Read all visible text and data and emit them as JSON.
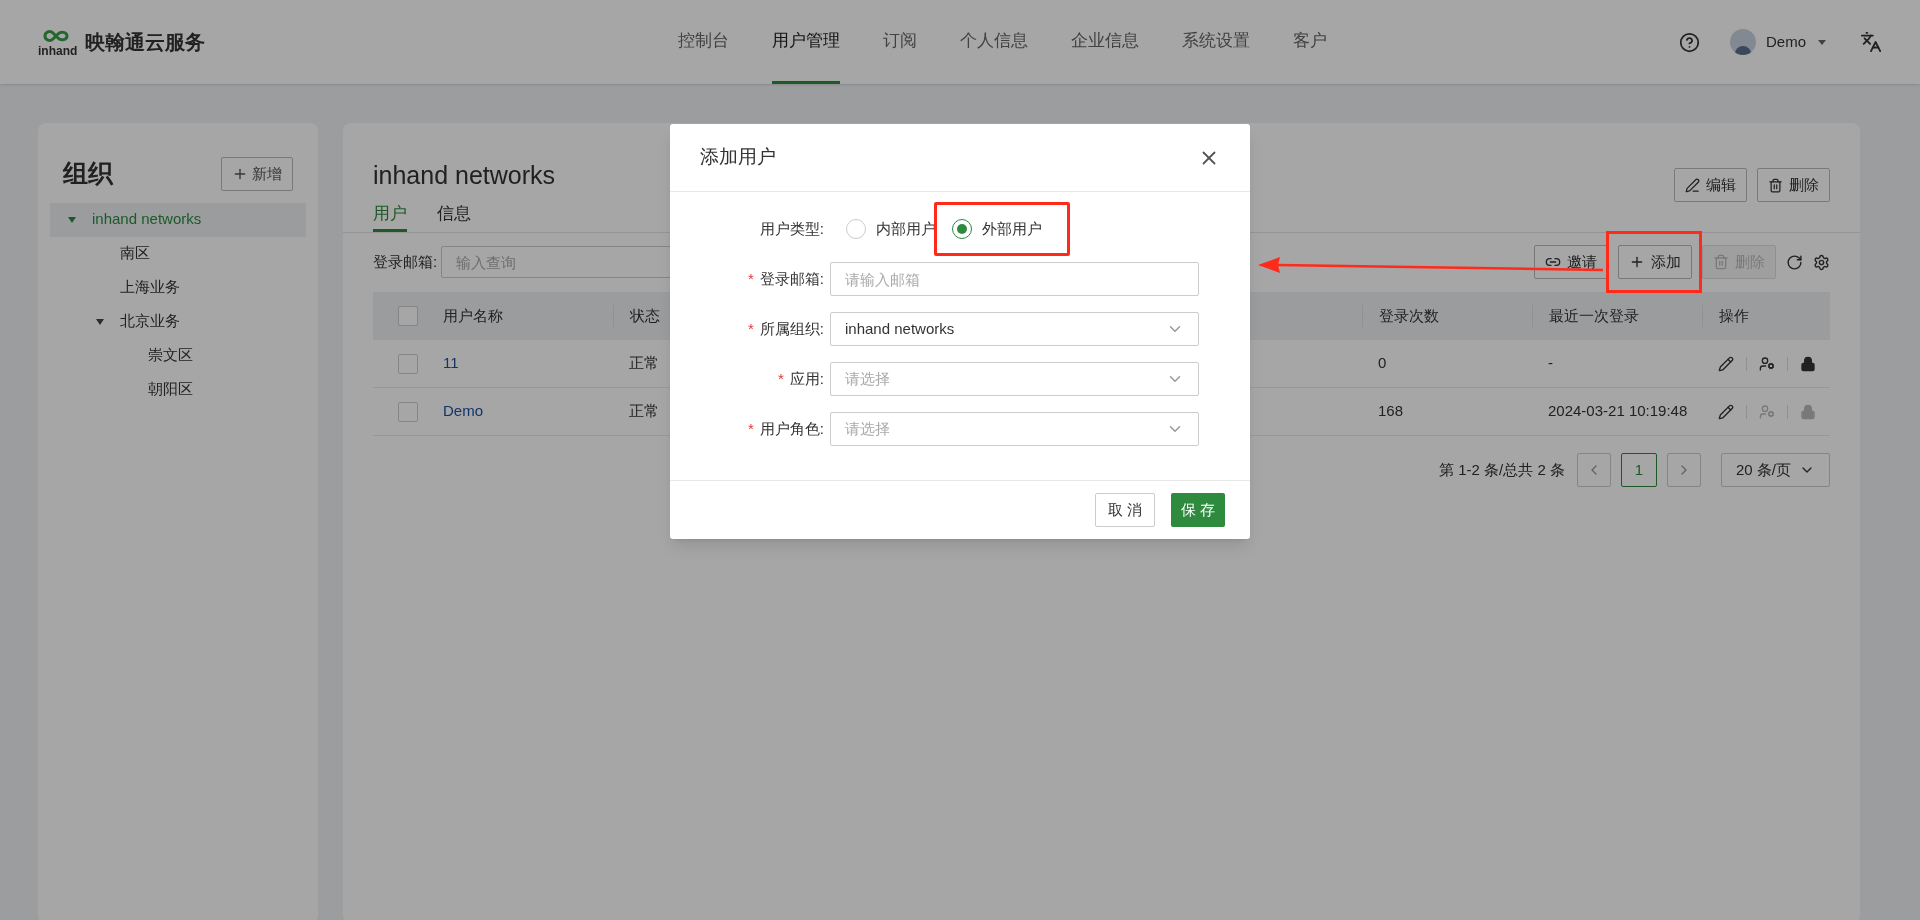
{
  "header": {
    "brand": "映翰通云服务",
    "logo_text": "inhand",
    "nav": [
      {
        "label": "控制台",
        "selected": false
      },
      {
        "label": "用户管理",
        "selected": true
      },
      {
        "label": "订阅",
        "selected": false
      },
      {
        "label": "个人信息",
        "selected": false
      },
      {
        "label": "企业信息",
        "selected": false
      },
      {
        "label": "系统设置",
        "selected": false
      },
      {
        "label": "客户",
        "selected": false
      }
    ],
    "user": "Demo"
  },
  "org_panel": {
    "title": "组织",
    "add_button": "新增",
    "tree": [
      {
        "label": "inhand networks",
        "selected": true,
        "expanded": true,
        "children": [
          {
            "label": "南区",
            "selected": false
          },
          {
            "label": "上海业务",
            "selected": false
          },
          {
            "label": "北京业务",
            "selected": false,
            "expanded": true,
            "children": [
              {
                "label": "崇文区",
                "selected": false
              },
              {
                "label": "朝阳区",
                "selected": false
              }
            ]
          }
        ]
      }
    ]
  },
  "main": {
    "title": "inhand networks",
    "edit_button": "编辑",
    "delete_button": "删除",
    "tabs": [
      {
        "label": "用户",
        "selected": true
      },
      {
        "label": "信息",
        "selected": false
      }
    ],
    "filter": {
      "label": "登录邮箱:",
      "placeholder": "输入查询"
    },
    "toolbar": [
      {
        "label": "邀请",
        "kind": "invite",
        "disabled": false,
        "highlighted": false
      },
      {
        "label": "添加",
        "kind": "add",
        "disabled": false,
        "highlighted": true
      },
      {
        "label": "删除",
        "kind": "delete",
        "disabled": true,
        "highlighted": false
      }
    ],
    "table": {
      "all_selected": false,
      "columns": [
        "用户名称",
        "状态",
        "登录次数",
        "最近一次登录",
        "操作"
      ],
      "rows": [
        {
          "selected": false,
          "name": "11",
          "status": "正常",
          "logins": "0",
          "last_login": "-",
          "actions": [
            {
              "kind": "edit",
              "disabled": false
            },
            {
              "kind": "switch-user",
              "disabled": false
            },
            {
              "kind": "lock",
              "disabled": false
            }
          ]
        },
        {
          "selected": false,
          "name": "Demo",
          "status": "正常",
          "logins": "168",
          "last_login": "2024-03-21 10:19:48",
          "actions": [
            {
              "kind": "edit",
              "disabled": false
            },
            {
              "kind": "switch-user",
              "disabled": true
            },
            {
              "kind": "lock",
              "disabled": true
            }
          ]
        }
      ]
    },
    "pagination": {
      "summary": "第 1-2 条/总共 2 条",
      "pages": [
        {
          "label": "1",
          "selected": true
        }
      ],
      "page_size": "20 条/页"
    }
  },
  "dialog": {
    "title": "添加用户",
    "user_type": {
      "label": "用户类型:",
      "options": [
        {
          "label": "内部用户",
          "selected": false,
          "highlighted": false
        },
        {
          "label": "外部用户",
          "selected": true,
          "highlighted": true
        }
      ]
    },
    "fields": [
      {
        "label": "登录邮箱:",
        "required_mark": "*",
        "kind": "input",
        "placeholder": "请输入邮箱"
      },
      {
        "label": "所属组织:",
        "required_mark": "*",
        "kind": "select",
        "value": "inhand networks"
      },
      {
        "label": "应用:",
        "required_mark": "*",
        "kind": "select",
        "placeholder": "请选择"
      },
      {
        "label": "用户角色:",
        "required_mark": "*",
        "kind": "select",
        "placeholder": "请选择"
      }
    ],
    "cancel": "取 消",
    "save": "保 存"
  }
}
